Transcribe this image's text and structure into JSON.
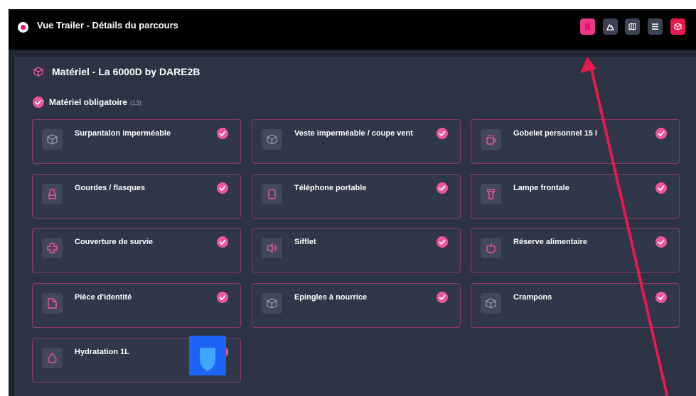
{
  "header": {
    "title": "Vue Trailer - Détails du parcours",
    "buttons": [
      {
        "name": "bookmark",
        "icon": "bookmark-icon",
        "color": "#e83a86"
      },
      {
        "name": "mountain",
        "icon": "mountain-icon",
        "color": "#3c4252"
      },
      {
        "name": "map",
        "icon": "map-icon",
        "color": "#3c4252"
      },
      {
        "name": "list",
        "icon": "list-icon",
        "color": "#3c4252"
      },
      {
        "name": "equipment",
        "icon": "cube-icon",
        "color": "#e8194e"
      }
    ]
  },
  "section": {
    "title": "Matériel - La 6000D by DARE2B",
    "icon": "cube-icon"
  },
  "mandatory": {
    "title": "Matériel obligatoire",
    "count": "(13)"
  },
  "items": [
    {
      "label": "Surpantalon imperméable",
      "icon": "cube-icon",
      "checked": true
    },
    {
      "label": "Veste imperméable / coupe vent",
      "icon": "cube-icon",
      "checked": true
    },
    {
      "label": "Gobelet personnel 15 l",
      "icon": "cup-icon",
      "checked": true
    },
    {
      "label": "Gourdes / flasques",
      "icon": "bottle-icon",
      "checked": true
    },
    {
      "label": "Téléphone portable",
      "icon": "phone-icon",
      "checked": true
    },
    {
      "label": "Lampe frontale",
      "icon": "flashlight-icon",
      "checked": true
    },
    {
      "label": "Couverture de survie",
      "icon": "cross-icon",
      "checked": true
    },
    {
      "label": "Sifflet",
      "icon": "speaker-icon",
      "checked": true
    },
    {
      "label": "Réserve alimentaire",
      "icon": "apple-icon",
      "checked": true
    },
    {
      "label": "Pièce d'identité",
      "icon": "document-icon",
      "checked": true
    },
    {
      "label": "Epingles à nourrice",
      "icon": "cube-icon",
      "checked": true
    },
    {
      "label": "Crampons",
      "icon": "cube-icon",
      "checked": true
    },
    {
      "label": "Hydratation 1L",
      "icon": "droplet-icon",
      "checked": true
    }
  ],
  "colors": {
    "accent": "#f0559b",
    "annotation_arrow": "#e8194e",
    "background": "#2c3444"
  }
}
